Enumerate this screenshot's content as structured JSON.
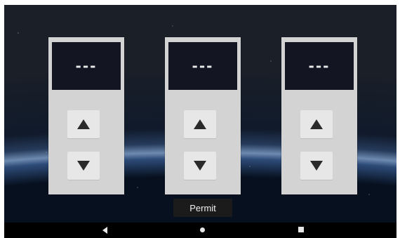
{
  "panels": [
    {
      "display": "---",
      "up_icon": "up-triangle-icon",
      "down_icon": "down-triangle-icon"
    },
    {
      "display": "---",
      "up_icon": "up-triangle-icon",
      "down_icon": "down-triangle-icon"
    },
    {
      "display": "---",
      "up_icon": "up-triangle-icon",
      "down_icon": "down-triangle-icon"
    }
  ],
  "actions": {
    "permit_label": "Permit"
  },
  "navbar": {
    "back_icon": "back-triangle-icon",
    "home_icon": "home-circle-icon",
    "recents_icon": "recents-square-icon"
  },
  "colors": {
    "panel": "#d3d3d3",
    "display_bg": "#131523",
    "button_bg": "#e7e7e7",
    "permit_bg": "#1b1b1b"
  }
}
